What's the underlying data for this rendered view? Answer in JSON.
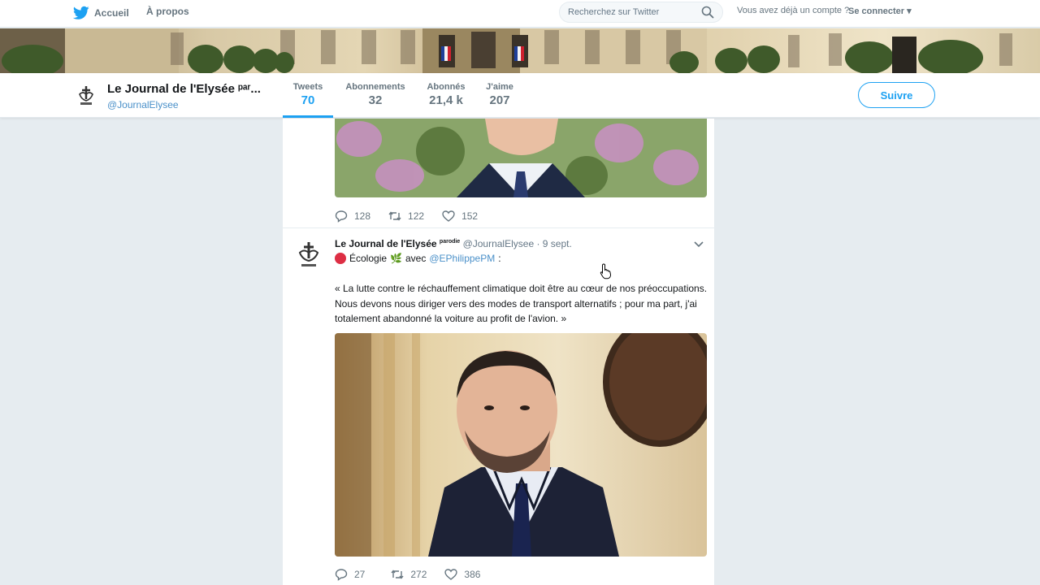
{
  "topnav": {
    "home_label": "Accueil",
    "about_label": "À propos",
    "search_placeholder": "Recherchez sur Twitter",
    "login_prompt": "Vous avez déjà un compte ?",
    "login_link": "Se connecter ▾"
  },
  "profile": {
    "name": "Le Journal de l'Elysée ᵖᵃʳ...",
    "handle": "@JournalElysee",
    "stats": [
      {
        "label": "Tweets",
        "value": "70"
      },
      {
        "label": "Abonnements",
        "value": "32"
      },
      {
        "label": "Abonnés",
        "value": "21,4 k"
      },
      {
        "label": "J'aime",
        "value": "207"
      }
    ],
    "follow_label": "Suivre"
  },
  "tweet1": {
    "replies": "128",
    "retweets": "122",
    "likes": "152"
  },
  "tweet2": {
    "name": "Le Journal de l'Elysée",
    "badge": "parodie",
    "handle": "@JournalElysee",
    "date": "· 9 sept.",
    "topic": "Écologie",
    "leaf": "🌿",
    "with_word": "avec",
    "mention": "@EPhilippePM",
    "colon": ":",
    "text": "« La lutte contre le réchauffement climatique doit être au cœur de nos préoccupations. Nous devons nous diriger vers des modes de transport alternatifs ; pour ma part, j'ai totalement abandonné la voiture au profit de l'avion. »",
    "replies": "27",
    "retweets": "272",
    "likes": "386"
  },
  "colors": {
    "accent": "#1da1f2",
    "background": "#e6ecf0",
    "secondary_text": "#66757f",
    "red_dot": "#dd2e44"
  },
  "icons": [
    "twitter-bird-icon",
    "search-icon",
    "reply-icon",
    "retweet-icon",
    "like-icon",
    "chevron-down-icon",
    "cursor-hand-icon",
    "red-circle-icon",
    "herb-icon"
  ]
}
